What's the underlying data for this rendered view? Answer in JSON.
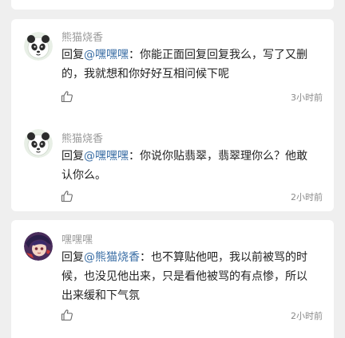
{
  "comments": [
    {
      "author": "熊猫烧香",
      "reply_prefix": "回复",
      "mention": "@嘿嘿嘿",
      "separator": "：",
      "text_line1": "你能正面回复回复我么，写了又删",
      "text_line2": "的，我就想和你好好互相问候下呢",
      "time": "3小时前",
      "avatar_icon": "panda-avatar-icon",
      "like_icon": "thumbs-up-icon"
    },
    {
      "author": "熊猫烧香",
      "reply_prefix": "回复",
      "mention": "@嘿嘿嘿",
      "separator": "：",
      "text_line1": "你说你贴翡翠，翡翠理你么？他敢",
      "text_line2": "认你么。",
      "time": "2小时前",
      "avatar_icon": "panda-avatar-icon",
      "like_icon": "thumbs-up-icon"
    },
    {
      "author": "嘿嘿嘿",
      "reply_prefix": "回复",
      "mention": "@熊猫烧香",
      "separator": "：",
      "text_line1": "也不算贴他吧，我以前被骂的时",
      "text_line2": "候，也没见他出来，只是看他被骂的有点惨，所以",
      "text_line3": "出来缓和下气氛",
      "time": "2小时前",
      "avatar_icon": "anime-avatar-icon",
      "like_icon": "thumbs-up-icon"
    }
  ],
  "colors": {
    "background": "#efefef",
    "card": "#ffffff",
    "author": "#9a9a9a",
    "text": "#222222",
    "time": "#8a8a8a"
  }
}
